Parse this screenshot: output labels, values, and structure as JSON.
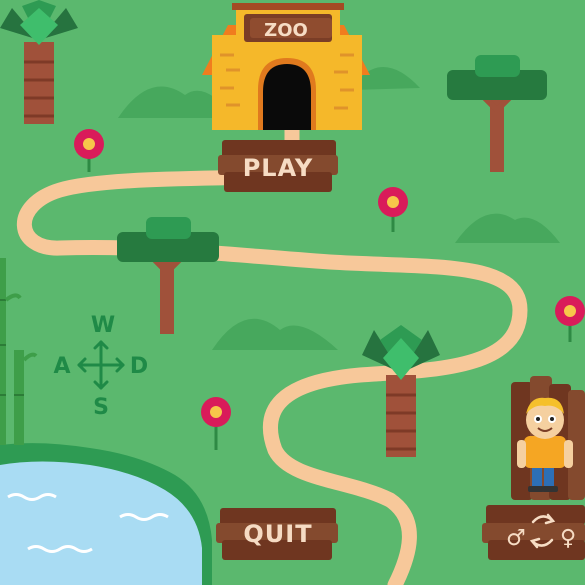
{
  "zoo_sign": "ZOO",
  "menu": {
    "play_label": "PLAY",
    "quit_label": "QUIT"
  },
  "controls": {
    "up": "W",
    "left": "A",
    "right": "D",
    "down": "S"
  },
  "gender_toggle": {
    "male_symbol": "♂",
    "female_symbol": "♀"
  },
  "colors": {
    "grass": "#5bb86e",
    "path": "#f7c89a",
    "wood": "#8a4a2e",
    "water": "#a9dcf3",
    "zoo_building": "#f5b82a"
  },
  "icons": {
    "move_arrows": "four-way-arrow-icon",
    "swap": "swap-arrows-icon"
  }
}
